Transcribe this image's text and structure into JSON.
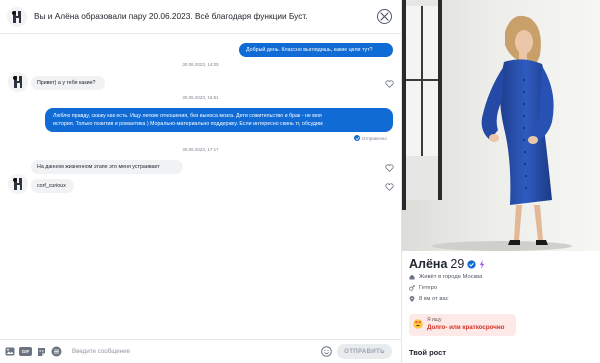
{
  "header": {
    "match_text": "Вы и Алёна образовали пару 20.06.2023. Всё благодаря функции Буст."
  },
  "messages": [
    {
      "type": "outgoing",
      "text": "Добрый день. Классно выглядишь, какие цели тут?"
    },
    {
      "type": "date",
      "text": "30.06.2023, 14:05"
    },
    {
      "type": "incoming",
      "text": "Привет) а у тебя какие?"
    },
    {
      "type": "date",
      "text": "30.06.2023, 16:51"
    },
    {
      "type": "outgoing",
      "lines": [
        "Люблю правду, скажу как есть. Ищу легкие отношения, без выноса мозга. Дети сожительство и брак - не моя",
        "история. Только позитив и романтика ) Морально-материально поддержку. Если интересно скинь тг, обсудим"
      ]
    },
    {
      "type": "status",
      "text": "Отправлено"
    },
    {
      "type": "date",
      "text": "30.06.2023, 17:17"
    },
    {
      "type": "incoming",
      "text": "На данном жизненном этапе это меня устраивает"
    },
    {
      "type": "incoming",
      "text": "corf_curioux"
    }
  ],
  "composer": {
    "placeholder": "Введите сообщение",
    "send_label": "ОТПРАВИТЬ",
    "gif_label": "GIF"
  },
  "profile": {
    "name": "Алёна",
    "age": "29",
    "facts": [
      {
        "icon": "home-icon",
        "text": "Живёт в городе Москва"
      },
      {
        "icon": "orientation-icon",
        "text": "Гетеро"
      },
      {
        "icon": "location-pin-icon",
        "text": "8 км от вас"
      }
    ],
    "seeking": {
      "label": "Я ищу",
      "value": "Долго- или краткосрочно",
      "icon": "heart-eyes-emoji-icon"
    },
    "section_title": "Твой рост"
  },
  "colors": {
    "accent": "#106bd5",
    "incoming_bubble": "#f0f2f4",
    "seeking_bg": "#fde9e8",
    "seeking_text": "#d43025"
  }
}
